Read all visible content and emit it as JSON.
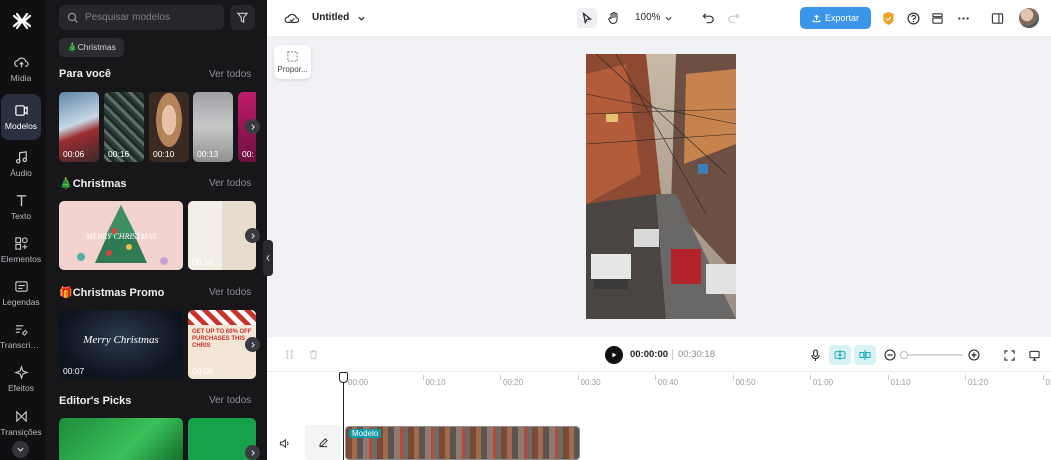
{
  "rail": {
    "items": [
      {
        "label": "Mídia",
        "icon": "cloud-upload-icon"
      },
      {
        "label": "Modelos",
        "icon": "template-icon"
      },
      {
        "label": "Áudio",
        "icon": "music-icon"
      },
      {
        "label": "Texto",
        "icon": "text-icon"
      },
      {
        "label": "Elementos",
        "icon": "shapes-icon"
      },
      {
        "label": "Legendas",
        "icon": "captions-icon"
      },
      {
        "label": "Transcrição",
        "icon": "transcript-icon"
      },
      {
        "label": "Efeitos",
        "icon": "effects-icon"
      },
      {
        "label": "Transições",
        "icon": "transitions-icon"
      }
    ],
    "active_index": 1
  },
  "panel": {
    "search_placeholder": "Pesquisar modelos",
    "chip": "🎄Christmas",
    "sections": [
      {
        "title": "Para você",
        "see_all": "Ver todos",
        "durations": [
          "00:06",
          "00:16",
          "00:10",
          "00:13",
          "00:"
        ]
      },
      {
        "title": "🎄Christmas",
        "see_all": "Ver todos",
        "durations": [
          "",
          "00:16"
        ],
        "overlay_text": "MERRY CHRISTMAS"
      },
      {
        "title": "🎁Christmas Promo",
        "see_all": "Ver todos",
        "durations": [
          "00:07",
          "00:08"
        ],
        "overlay_text": "Merry Christmas",
        "promo_text": "GET UP TO 60% OFF PURCHASES THIS CHRIS"
      },
      {
        "title": "Editor's Picks",
        "see_all": "Ver todos",
        "durations": []
      }
    ]
  },
  "topbar": {
    "title": "Untitled",
    "zoom": "100%",
    "export_label": "Exportar",
    "colors": {
      "export": "#3b95e8",
      "shield": "#f0a020"
    }
  },
  "canvas": {
    "ratio_label": "Propor..."
  },
  "player": {
    "current_time": "00:00:00",
    "total_time": "00:30:18"
  },
  "timeline": {
    "ticks": [
      "00:00",
      "00:10",
      "00:20",
      "00:30",
      "00:40",
      "00:50",
      "01:00",
      "01:10",
      "01:20",
      "01:"
    ],
    "clip_label": "Modelo"
  }
}
